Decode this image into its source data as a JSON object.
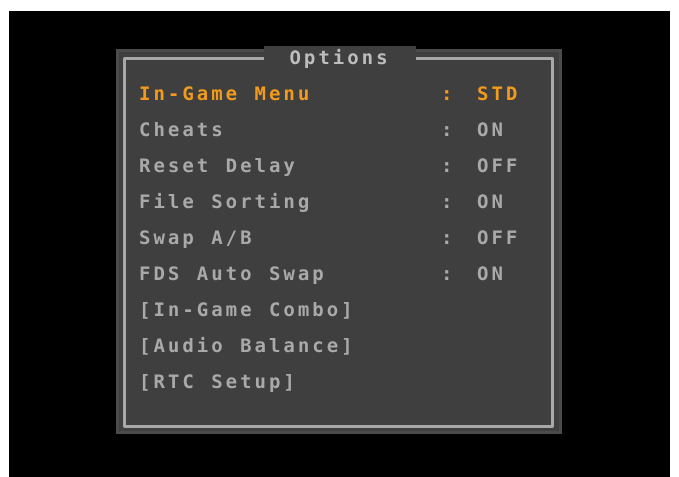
{
  "title": "Options",
  "colors": {
    "background": "#000000",
    "panel": "#3f3f3f",
    "frame": "#a8a8a8",
    "text": "#a9a9a9",
    "selected": "#f29a1c"
  },
  "items": [
    {
      "label": "In-Game Menu",
      "separator": ":",
      "value": "STD"
    },
    {
      "label": "Cheats",
      "separator": ":",
      "value": "ON"
    },
    {
      "label": "Reset Delay",
      "separator": ":",
      "value": "OFF"
    },
    {
      "label": "File Sorting",
      "separator": ":",
      "value": "ON"
    },
    {
      "label": "Swap A/B",
      "separator": ":",
      "value": "OFF"
    },
    {
      "label": "FDS Auto Swap",
      "separator": ":",
      "value": "ON"
    },
    {
      "label": "[In-Game Combo]"
    },
    {
      "label": "[Audio Balance]"
    },
    {
      "label": "[RTC Setup]"
    }
  ]
}
